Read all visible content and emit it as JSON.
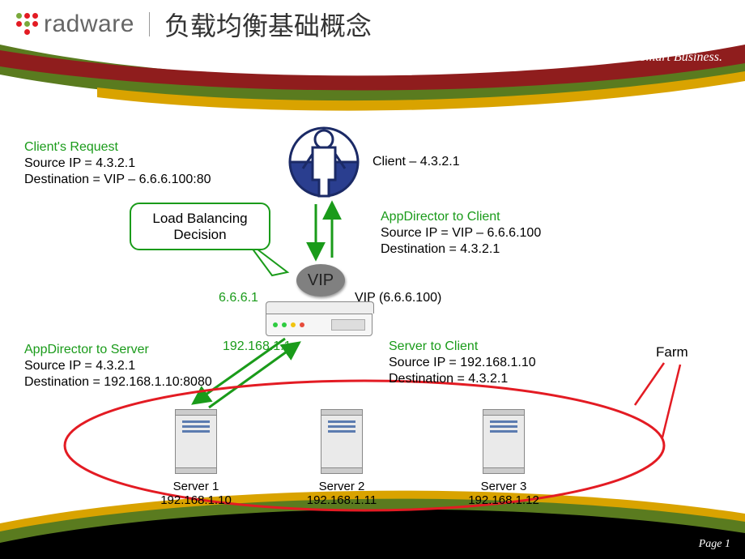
{
  "brand": {
    "name": "radware",
    "tagline": "Smart Network. Smart Business."
  },
  "title": "负载均衡基础概念",
  "client": {
    "label": "Client – 4.3.2.1"
  },
  "client_request": {
    "heading": "Client's Request",
    "l1": "Source IP = 4.3.2.1",
    "l2": "Destination = VIP – 6.6.6.100:80"
  },
  "callout": "Load Balancing Decision",
  "appdir_to_client": {
    "heading": "AppDirector to Client",
    "l1": "Source IP = VIP – 6.6.6.100",
    "l2": "Destination = 4.3.2.1"
  },
  "vip": {
    "badge": "VIP",
    "label": "VIP (6.6.6.100)",
    "ip_left": "6.6.6.1"
  },
  "appdir_to_server": {
    "heading": "AppDirector to Server",
    "l1": "Source IP = 4.3.2.1",
    "l2": "Destination = 192.168.1.10:8080"
  },
  "server_to_client": {
    "heading": "Server to Client",
    "l1": "Source IP = 192.168.1.10",
    "l2": "Destination = 4.3.2.1"
  },
  "iface_bottom": "192.168.1.1",
  "farm": {
    "label": "Farm",
    "servers": [
      {
        "name": "Server 1",
        "ip": "192.168.1.10"
      },
      {
        "name": "Server 2",
        "ip": "192.168.1.11"
      },
      {
        "name": "Server 3",
        "ip": "192.168.1.12"
      }
    ]
  },
  "page": "Page 1"
}
